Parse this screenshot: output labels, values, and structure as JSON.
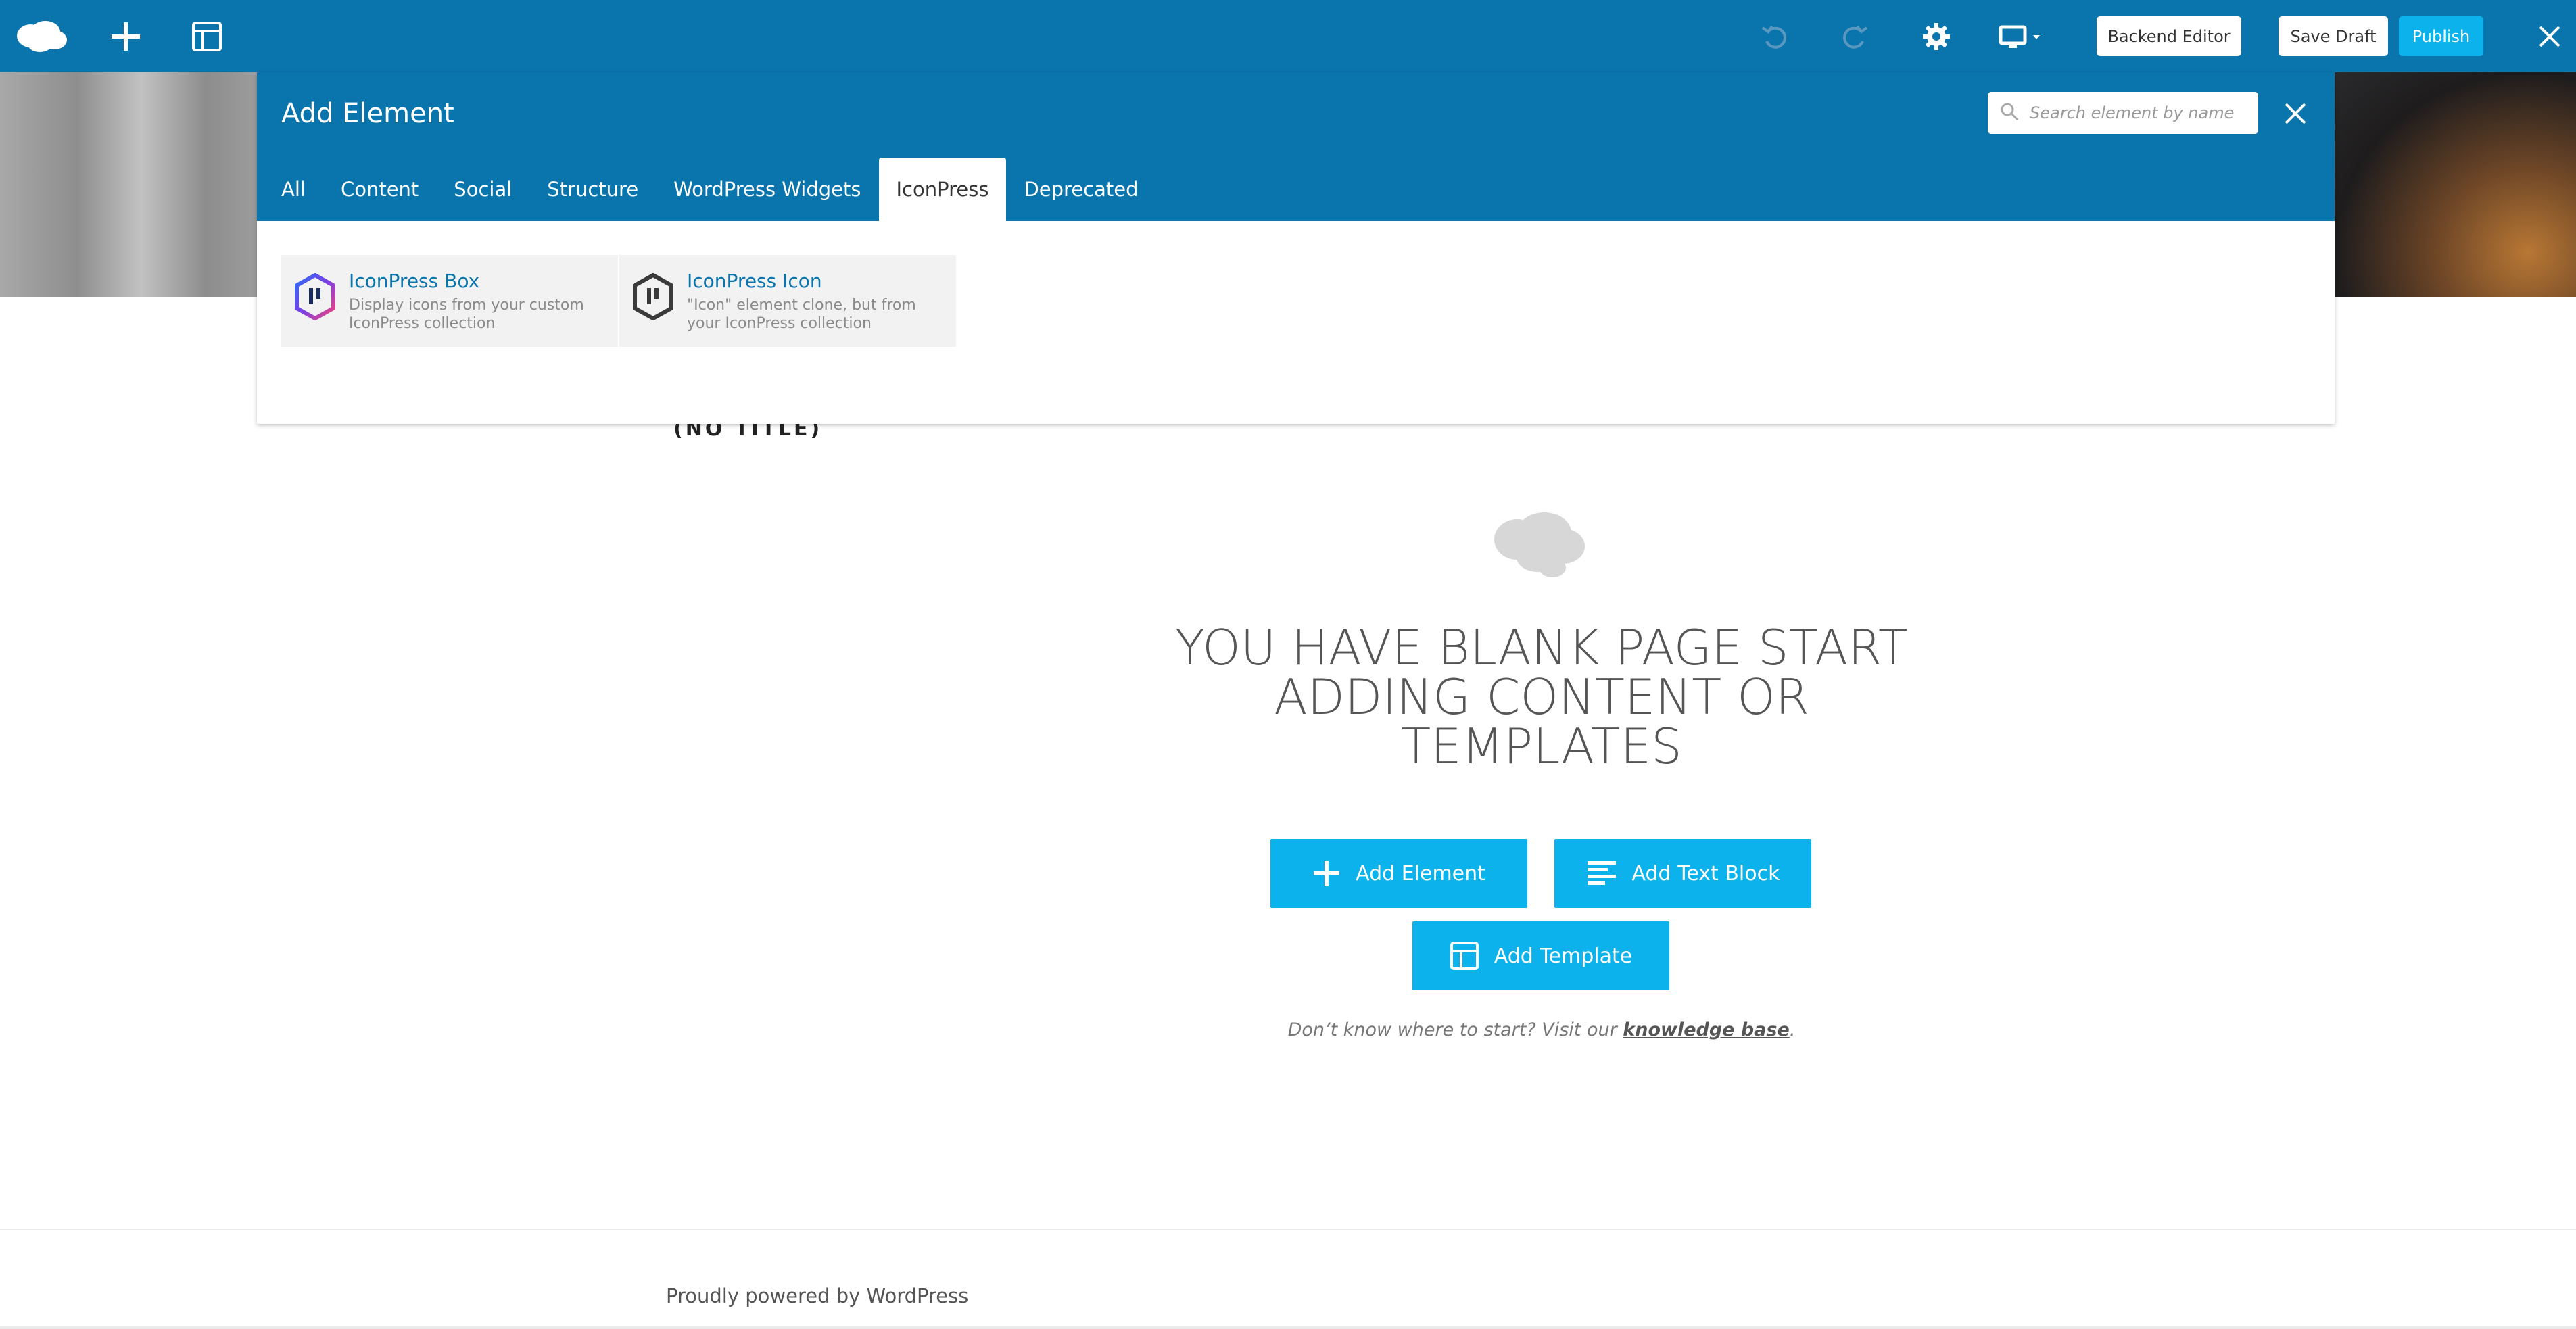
{
  "toolbar": {
    "backend_editor_label": "Backend Editor",
    "save_draft_label": "Save Draft",
    "publish_label": "Publish",
    "accent_color": "#0a74ad",
    "publish_color": "#0cb2ec"
  },
  "panel": {
    "title": "Add Element",
    "search_placeholder": "Search element by name",
    "tabs": [
      {
        "label": "All",
        "active": false
      },
      {
        "label": "Content",
        "active": false
      },
      {
        "label": "Social",
        "active": false
      },
      {
        "label": "Structure",
        "active": false
      },
      {
        "label": "WordPress Widgets",
        "active": false
      },
      {
        "label": "IconPress",
        "active": true
      },
      {
        "label": "Deprecated",
        "active": false
      }
    ],
    "elements": [
      {
        "title": "IconPress Box",
        "description": "Display icons from your custom IconPress collection",
        "icon": "iconpress-box-icon"
      },
      {
        "title": "IconPress Icon",
        "description": "\"Icon\" element clone, but from your IconPress collection",
        "icon": "iconpress-icon-icon"
      }
    ]
  },
  "page": {
    "post_title": "(NO TITLE)",
    "blank_heading": "YOU HAVE BLANK PAGE START ADDING CONTENT OR TEMPLATES",
    "add_element_label": "Add Element",
    "add_text_block_label": "Add Text Block",
    "add_template_label": "Add Template",
    "help_prefix": "Don’t know where to start? Visit our ",
    "help_link": "knowledge base",
    "help_suffix": ".",
    "footer": "Proudly powered by WordPress"
  }
}
